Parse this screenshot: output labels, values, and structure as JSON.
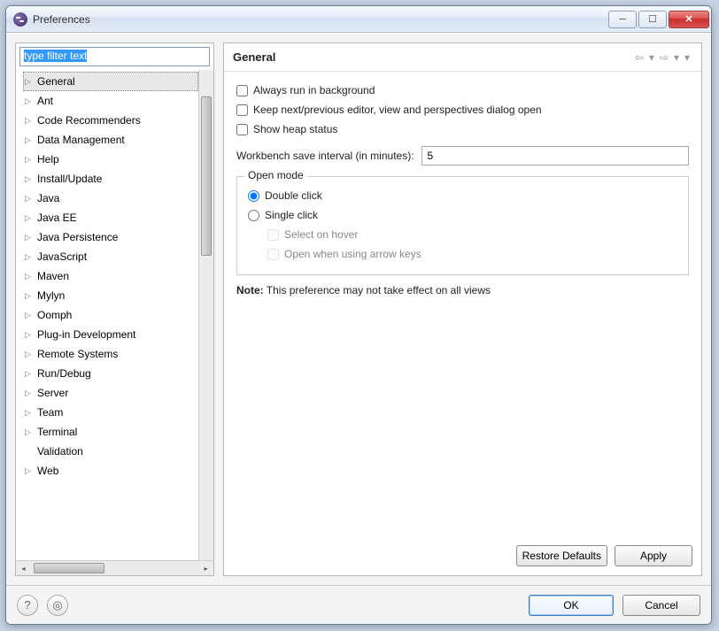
{
  "window": {
    "title": "Preferences"
  },
  "filter": {
    "placeholder": "type filter text",
    "value": "type filter text"
  },
  "tree": {
    "items": [
      {
        "label": "General",
        "expandable": true,
        "selected": true
      },
      {
        "label": "Ant",
        "expandable": true
      },
      {
        "label": "Code Recommenders",
        "expandable": true
      },
      {
        "label": "Data Management",
        "expandable": true
      },
      {
        "label": "Help",
        "expandable": true
      },
      {
        "label": "Install/Update",
        "expandable": true
      },
      {
        "label": "Java",
        "expandable": true
      },
      {
        "label": "Java EE",
        "expandable": true
      },
      {
        "label": "Java Persistence",
        "expandable": true
      },
      {
        "label": "JavaScript",
        "expandable": true
      },
      {
        "label": "Maven",
        "expandable": true
      },
      {
        "label": "Mylyn",
        "expandable": true
      },
      {
        "label": "Oomph",
        "expandable": true
      },
      {
        "label": "Plug-in Development",
        "expandable": true
      },
      {
        "label": "Remote Systems",
        "expandable": true
      },
      {
        "label": "Run/Debug",
        "expandable": true
      },
      {
        "label": "Server",
        "expandable": true
      },
      {
        "label": "Team",
        "expandable": true
      },
      {
        "label": "Terminal",
        "expandable": true
      },
      {
        "label": "Validation",
        "expandable": false
      },
      {
        "label": "Web",
        "expandable": true
      }
    ]
  },
  "page": {
    "title": "General",
    "checks": {
      "always_bg": "Always run in background",
      "keep_dialog": "Keep next/previous editor, view and perspectives dialog open",
      "heap": "Show heap status"
    },
    "save_interval": {
      "label": "Workbench save interval (in minutes):",
      "value": "5"
    },
    "open_mode": {
      "title": "Open mode",
      "double": "Double click",
      "single": "Single click",
      "hover": "Select on hover",
      "arrows": "Open when using arrow keys"
    },
    "note": {
      "prefix": "Note:",
      "text": " This preference may not take effect on all views"
    }
  },
  "buttons": {
    "restore": "Restore Defaults",
    "apply": "Apply",
    "ok": "OK",
    "cancel": "Cancel"
  }
}
